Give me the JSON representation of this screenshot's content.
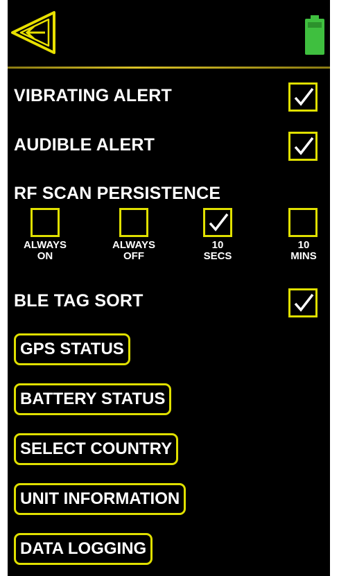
{
  "header": {
    "back_icon": "back-arrow-icon",
    "battery_icon": "battery-full-icon",
    "accent_color": "#e0e000",
    "battery_color": "#3fbf3f"
  },
  "settings": {
    "vibrating_alert": {
      "label": "VIBRATING ALERT",
      "checked": true
    },
    "audible_alert": {
      "label": "AUDIBLE ALERT",
      "checked": true
    },
    "rf_scan_persistence": {
      "label": "RF SCAN PERSISTENCE",
      "options": [
        {
          "label": "ALWAYS\nON",
          "checked": false
        },
        {
          "label": "ALWAYS\nOFF",
          "checked": false
        },
        {
          "label": "10\nSECS",
          "checked": true
        },
        {
          "label": "10\nMINS",
          "checked": false
        }
      ]
    },
    "ble_tag_sort": {
      "label": "BLE TAG SORT",
      "checked": true
    }
  },
  "menu": [
    {
      "label": "GPS STATUS"
    },
    {
      "label": "BATTERY STATUS"
    },
    {
      "label": "SELECT COUNTRY"
    },
    {
      "label": "UNIT INFORMATION"
    },
    {
      "label": "DATA LOGGING"
    }
  ]
}
